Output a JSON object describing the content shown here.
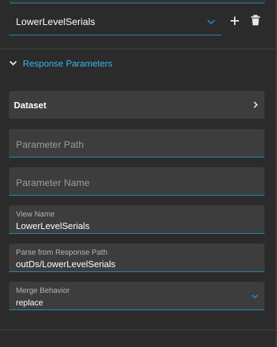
{
  "colors": {
    "background": "#2b2b2b",
    "field_background": "#3d3d3d",
    "accent": "#1e8fc9",
    "section_title": "#3ab4f0",
    "placeholder": "#9a9a9a",
    "label": "#b4b4b4",
    "text": "#ffffff"
  },
  "selector": {
    "value": "LowerLevelSerials",
    "icon": "chevron-down-icon"
  },
  "actions": {
    "add_icon": "plus-icon",
    "delete_icon": "trash-icon"
  },
  "section": {
    "title": "Response Parameters",
    "icon": "chevron-down-icon",
    "expanded": true
  },
  "dataset": {
    "label": "Dataset",
    "icon": "chevron-right-icon"
  },
  "fields": {
    "parameter_path": {
      "placeholder": "Parameter Path",
      "value": ""
    },
    "parameter_name": {
      "placeholder": "Parameter Name",
      "value": ""
    },
    "view_name": {
      "label": "View Name",
      "value": "LowerLevelSerials"
    },
    "parse_path": {
      "label": "Parse from Response Path",
      "value": "outDs/LowerLevelSerials"
    },
    "merge_behavior": {
      "label": "Merge Behavior",
      "value": "replace",
      "icon": "chevron-down-icon"
    }
  }
}
